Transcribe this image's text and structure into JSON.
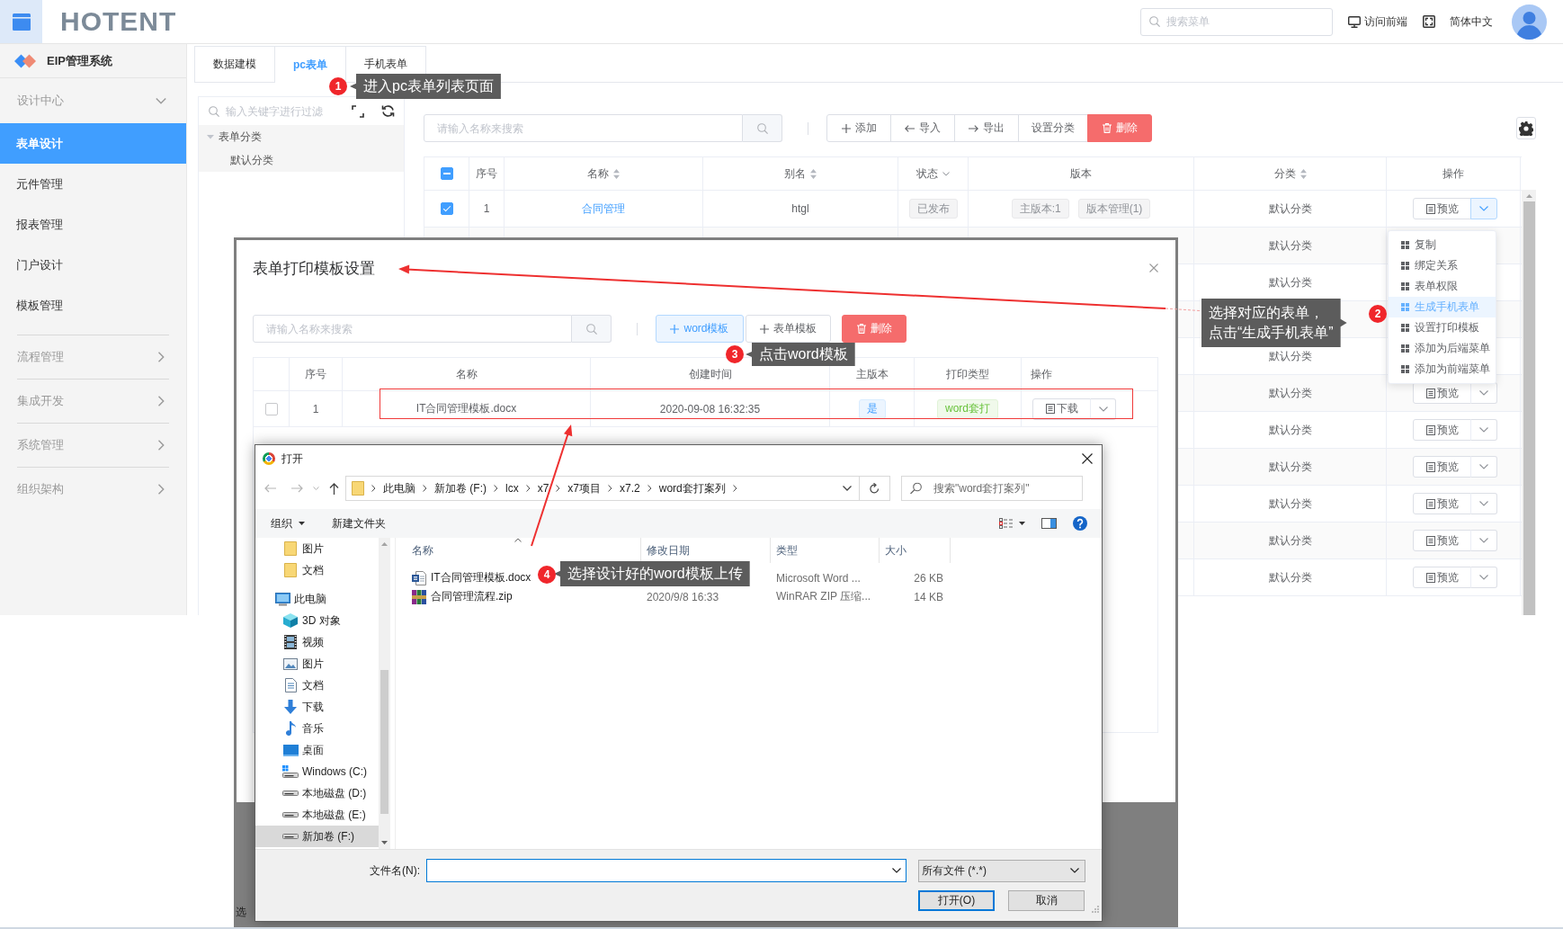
{
  "header": {
    "logo": "HOTENT",
    "search_placeholder": "搜索菜单",
    "frontend_link": "访问前端",
    "language": "简体中文"
  },
  "sidebar": {
    "title": "EIP管理系统",
    "groups": [
      {
        "label": "设计中心",
        "expanded": true,
        "children": [
          {
            "label": "表单设计",
            "selected": true
          },
          {
            "label": "元件管理",
            "selected": false
          },
          {
            "label": "报表管理",
            "selected": false
          },
          {
            "label": "门户设计",
            "selected": false
          },
          {
            "label": "模板管理",
            "selected": false
          }
        ]
      },
      {
        "label": "流程管理",
        "expanded": false
      },
      {
        "label": "集成开发",
        "expanded": false
      },
      {
        "label": "系统管理",
        "expanded": false
      },
      {
        "label": "组织架构",
        "expanded": false
      }
    ]
  },
  "tabs": [
    {
      "label": "数据建模",
      "selected": false
    },
    {
      "label": "pc表单",
      "selected": true
    },
    {
      "label": "手机表单",
      "selected": false
    }
  ],
  "tree": {
    "filter_placeholder": "输入关键字进行过滤",
    "nodes": [
      {
        "label": "表单分类",
        "expanded": true,
        "children": [
          {
            "label": "默认分类"
          }
        ]
      }
    ]
  },
  "toolbar": {
    "search_placeholder": "请输入名称来搜索",
    "buttons": [
      {
        "label": "添加",
        "kind": "add"
      },
      {
        "label": "导入",
        "kind": "import"
      },
      {
        "label": "导出",
        "kind": "export"
      },
      {
        "label": "设置分类",
        "kind": "plain"
      },
      {
        "label": "删除",
        "kind": "delete"
      }
    ]
  },
  "table": {
    "select_all": {
      "indeterminate": true
    },
    "columns": [
      {
        "label": "序号",
        "kind": "plain"
      },
      {
        "label": "名称",
        "kind": "sortable"
      },
      {
        "label": "别名",
        "kind": "sortable"
      },
      {
        "label": "状态",
        "kind": "filter"
      },
      {
        "label": "版本",
        "kind": "plain"
      },
      {
        "label": "分类",
        "kind": "sortable"
      },
      {
        "label": "操作",
        "kind": "plain"
      }
    ],
    "rows": [
      {
        "checked": true,
        "index": "1",
        "name": "合同管理",
        "alias": "htgl",
        "status": "已发布",
        "versions": [
          "主版本:1",
          "版本管理(1)"
        ],
        "category": "默认分类",
        "action": "预览",
        "menu_open": true
      },
      {
        "category": "默认分类"
      },
      {
        "category": "默认分类"
      },
      {},
      {
        "category": "默认分类"
      },
      {
        "category": "默认分类",
        "action": "预览",
        "menu_open": false
      },
      {
        "category": "默认分类",
        "action": "预览",
        "menu_open": false
      },
      {
        "category": "默认分类",
        "action": "预览",
        "menu_open": false
      },
      {
        "category": "默认分类",
        "action": "预览",
        "menu_open": false
      },
      {
        "category": "默认分类",
        "action": "预览",
        "menu_open": false
      },
      {
        "category": "默认分类",
        "action": "预览",
        "menu_open": false
      }
    ]
  },
  "row_menu": {
    "items": [
      {
        "label": "复制",
        "selected": false
      },
      {
        "label": "绑定关系",
        "selected": false
      },
      {
        "label": "表单权限",
        "selected": false
      },
      {
        "label": "生成手机表单",
        "selected": true
      },
      {
        "label": "设置打印模板",
        "selected": false
      },
      {
        "label": "添加为后端菜单",
        "selected": false
      },
      {
        "label": "添加为前端菜单",
        "selected": false
      }
    ]
  },
  "print_dialog": {
    "title": "表单打印模板设置",
    "search_placeholder": "请输入名称来搜索",
    "buttons": [
      {
        "label": "word模板",
        "kind": "primary"
      },
      {
        "label": "表单模板",
        "kind": "add"
      },
      {
        "label": "删除",
        "kind": "delete"
      }
    ],
    "columns": [
      {
        "label": "序号"
      },
      {
        "label": "名称"
      },
      {
        "label": "创建时间"
      },
      {
        "label": "主版本"
      },
      {
        "label": "打印类型"
      },
      {
        "label": "操作"
      }
    ],
    "rows": [
      {
        "checked": false,
        "index": "1",
        "name": "IT合同管理模板.docx",
        "created": "2020-09-08 16:32:35",
        "main_version": "是",
        "print_type": "word套打",
        "action": "下载"
      }
    ]
  },
  "backdrop_fragment": "选",
  "file_dialog": {
    "title": "打开",
    "path": [
      "此电脑",
      "新加卷 (F:)",
      "lcx",
      "x7",
      "x7项目",
      "x7.2",
      "word套打案列"
    ],
    "search_placeholder": "搜索\"word套打案列\"",
    "commands": [
      {
        "label": "组织",
        "kind": "menu"
      },
      {
        "label": "新建文件夹",
        "kind": "plain"
      }
    ],
    "nav_tree": [
      {
        "children": [
          {
            "label": "图片",
            "kind": "folder",
            "selected": false
          },
          {
            "label": "文档",
            "kind": "folder",
            "selected": false
          }
        ]
      },
      {
        "label": "此电脑",
        "kind": "pc",
        "selected": false,
        "children": [
          {
            "label": "3D 对象",
            "kind": "objects",
            "selected": false
          },
          {
            "label": "视频",
            "kind": "video",
            "selected": false
          },
          {
            "label": "图片",
            "kind": "pictures",
            "selected": false
          },
          {
            "label": "文档",
            "kind": "documents",
            "selected": false
          },
          {
            "label": "下载",
            "kind": "download",
            "selected": false
          },
          {
            "label": "音乐",
            "kind": "music",
            "selected": false
          },
          {
            "label": "桌面",
            "kind": "desktop",
            "selected": false
          },
          {
            "label": "Windows (C:)",
            "kind": "sysdrive",
            "selected": false
          },
          {
            "label": "本地磁盘 (D:)",
            "kind": "drive",
            "selected": false
          },
          {
            "label": "本地磁盘 (E:)",
            "kind": "drive",
            "selected": false
          },
          {
            "label": "新加卷 (F:)",
            "kind": "drive",
            "selected": true
          }
        ]
      }
    ],
    "columns": [
      {
        "label": "名称",
        "sorted": true
      },
      {
        "label": "修改日期",
        "sorted": false
      },
      {
        "label": "类型",
        "sorted": false
      },
      {
        "label": "大小",
        "sorted": false
      }
    ],
    "files": [
      {
        "name": "IT合同管理模板.docx",
        "kind": "word",
        "type": "Microsoft Word ...",
        "size": "26 KB"
      },
      {
        "name": "合同管理流程.zip",
        "kind": "zip",
        "modified": "2020/9/8 16:33",
        "type": "WinRAR ZIP 压缩...",
        "size": "14 KB"
      }
    ],
    "filename_label": "文件名(N):",
    "file_type": "所有文件 (*.*)",
    "buttons": [
      {
        "label": "打开(O)",
        "kind": "primary"
      },
      {
        "label": "取消",
        "kind": "secondary"
      }
    ]
  },
  "annotations": [
    {
      "number": "1",
      "lines": [
        "进入pc表单列表页面"
      ]
    },
    {
      "number": "2",
      "lines": [
        "选择对应的表单，",
        "点击“生成手机表单”"
      ]
    },
    {
      "number": "3",
      "lines": [
        "点击word模板"
      ]
    },
    {
      "number": "4",
      "lines": [
        "选择设计好的word模板上传"
      ]
    }
  ]
}
